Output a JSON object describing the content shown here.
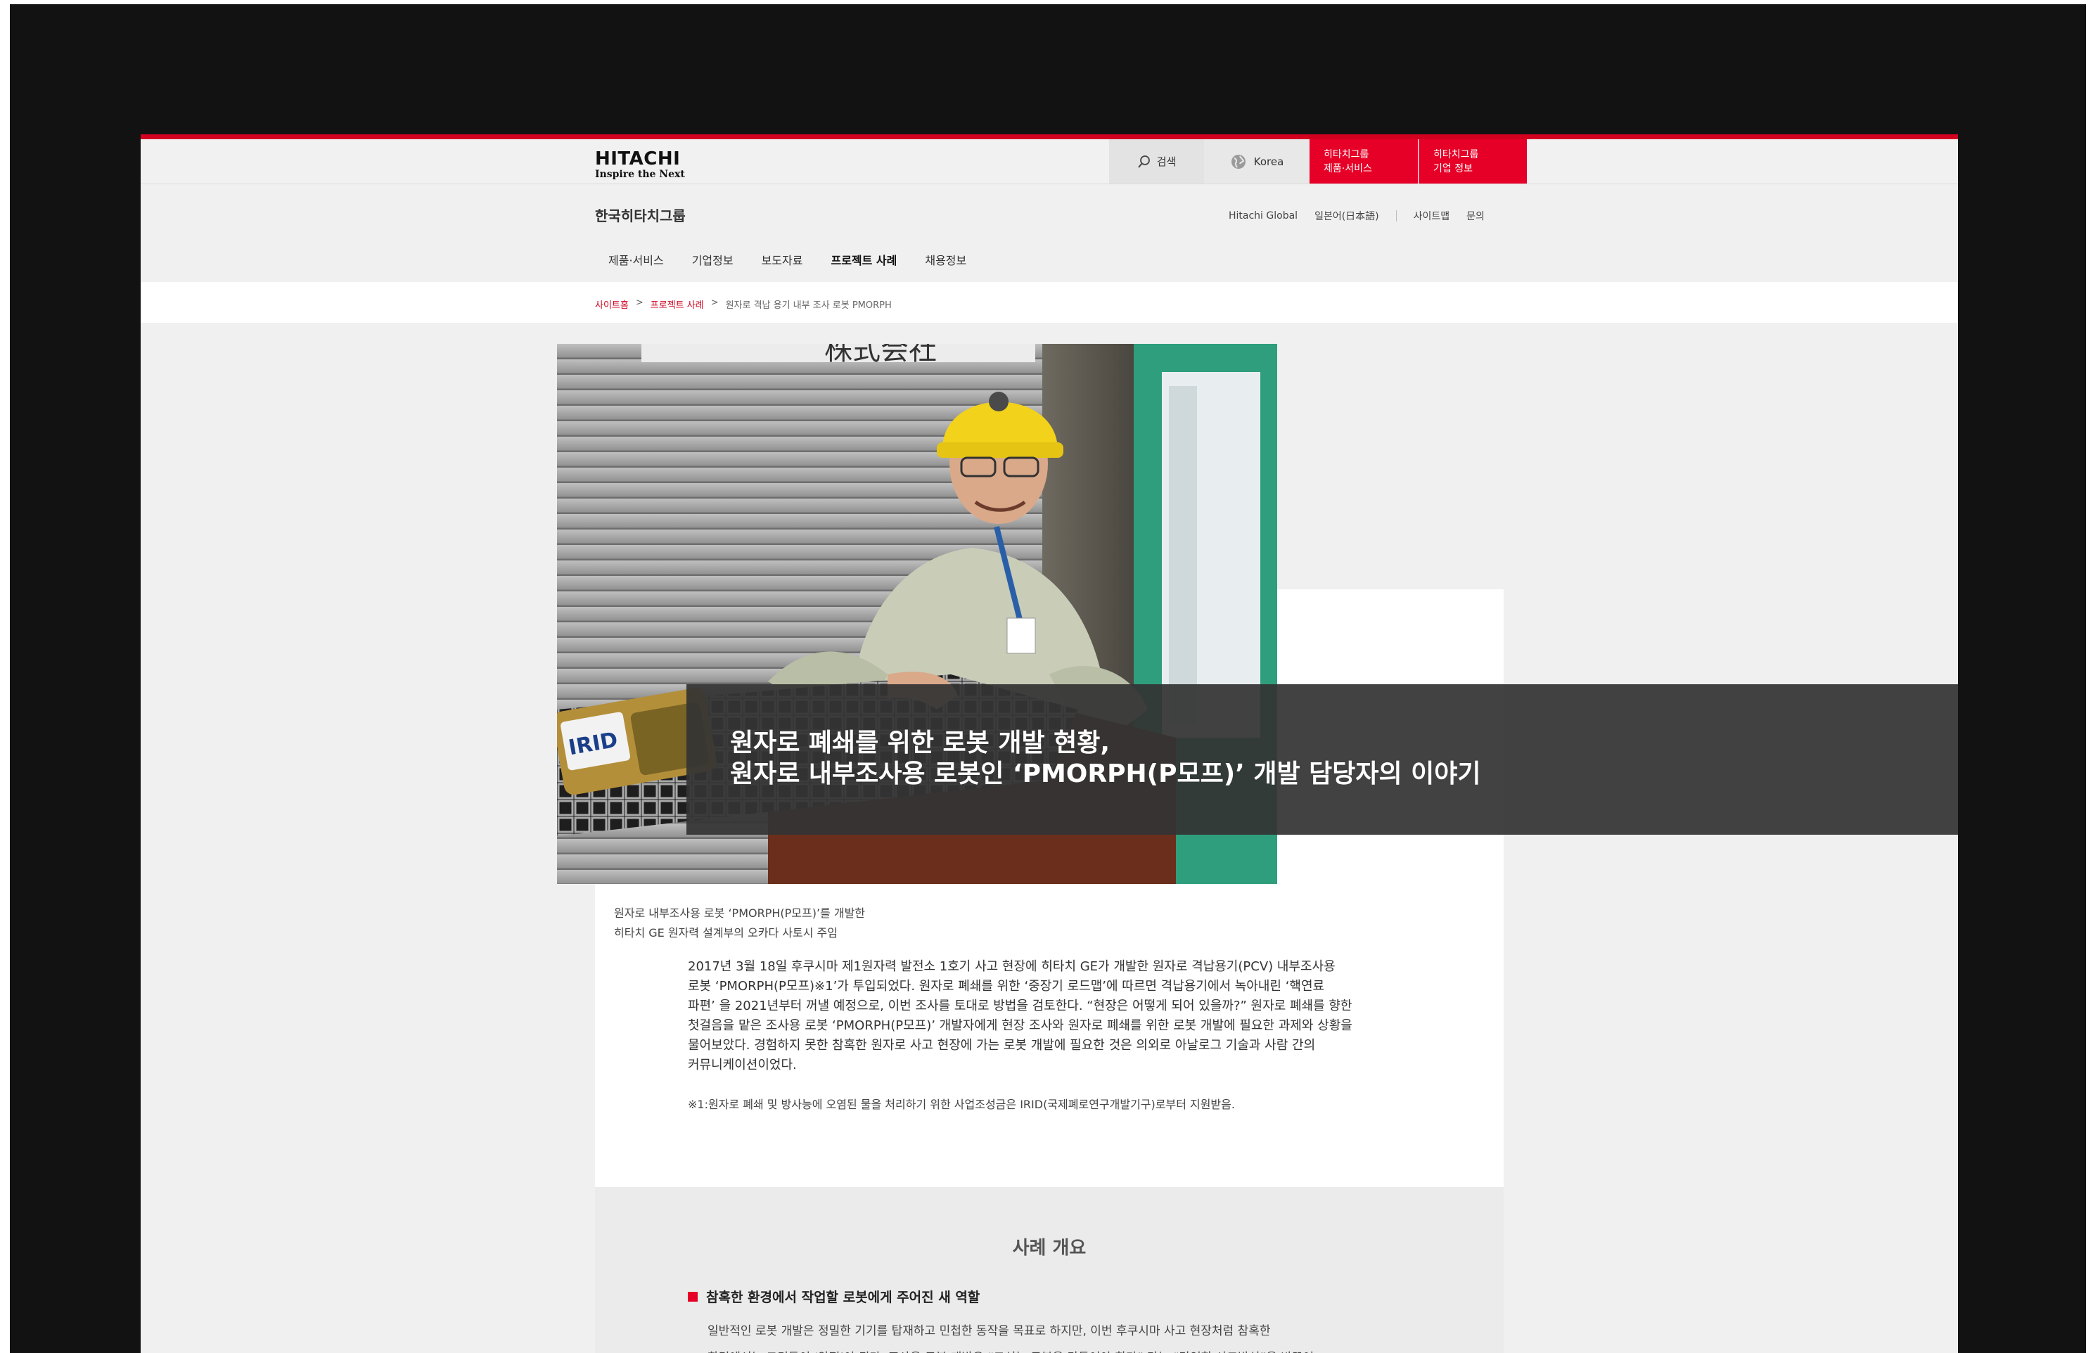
{
  "header": {
    "logo_brand": "HITACHI",
    "logo_tagline": "Inspire the Next",
    "search_label": "검색",
    "region_label": "Korea",
    "group_products_label": [
      "히타치그룹",
      "제품·서비스"
    ],
    "group_corp_label": [
      "히타치그룹",
      "기업 정보"
    ]
  },
  "site_title": "한국히타치그룹",
  "util_links": [
    "Hitachi Global",
    "일본어(日本語)",
    "사이트맵",
    "문의"
  ],
  "nav": {
    "items": [
      "제품·서비스",
      "기업정보",
      "보도자료",
      "프로젝트 사례",
      "채용정보"
    ],
    "active": "프로젝트 사례"
  },
  "breadcrumb": {
    "items": [
      "사이트홈",
      "프로젝트 사례",
      "원자로 격납 용기 내부 조사 로봇 PMORPH"
    ],
    "separator": ">"
  },
  "hero": {
    "title_line1": "원자로 폐쇄를 위한 로봇 개발 현황,",
    "title_line2": "원자로 내부조사용 로봇인 ‘PMORPH(P모프)’ 개발 담당자의 이야기"
  },
  "caption": {
    "line1": "원자로 내부조사용 로봇 ‘PMORPH(P모프)’를 개발한",
    "line2": "히타치 GE 원자력 설계부의 오카다 사토시 주임"
  },
  "intro_lines": [
    "2017년 3월 18일 후쿠시마 제1원자력 발전소 1호기 사고 현장에 히타치 GE가 개발한 원자로 격납용기(PCV) 내부조사용",
    "로봇 ‘PMORPH(P모프)※1’가 투입되었다. 원자로 폐쇄를 위한 ‘중장기 로드맵’에 따르면 격납용기에서 녹아내린 ‘핵연료",
    "파편’ 을 2021년부터 꺼낼 예정으로, 이번 조사를 토대로 방법을 검토한다. “현장은 어떻게 되어 있을까?” 원자로 폐쇄를 향한",
    "첫걸음을 맡은 조사용 로봇 ‘PMORPH(P모프)’ 개발자에게 현장 조사와 원자로 폐쇄를 위한 로봇 개발에 필요한 과제와 상황을",
    "물어보았다. 경험하지 못한 참혹한 원자로 사고 현장에 가는 로봇 개발에 필요한 것은 의외로 아날로그 기술과 사람 간의",
    "커뮤니케이션이었다."
  ],
  "footnote": "※1:원자로 폐쇄 및 방사능에 오염된 물을 처리하기 위한 사업조성금은 IRID(국제폐로연구개발기구)로부터 지원받음.",
  "overview": {
    "title": "사례 개요",
    "subheading": "참혹한 환경에서 작업할 로봇에게 주어진 새 역할",
    "lines": [
      "일반적인 로봇 개발은 정밀한 기기를 탑재하고 민첩한 동작을 목표로 하지만, 이번 후쿠시마 사고 현장처럼 참혹한",
      "환경에서는 그것들이 ‘약점’이 된다. 조사용 로봇 개발은 “고성능 로봇을 만들어야 한다” 라는 “당연한 사고방식”을 바꾸어,"
    ]
  },
  "photo": {
    "sign_text": "株式会社",
    "robot_label": "IRID"
  },
  "colors": {
    "accent_red": "#e60027",
    "topbar_red_line": "#d1001f",
    "overlay": "#343434",
    "frame": "#121212"
  }
}
